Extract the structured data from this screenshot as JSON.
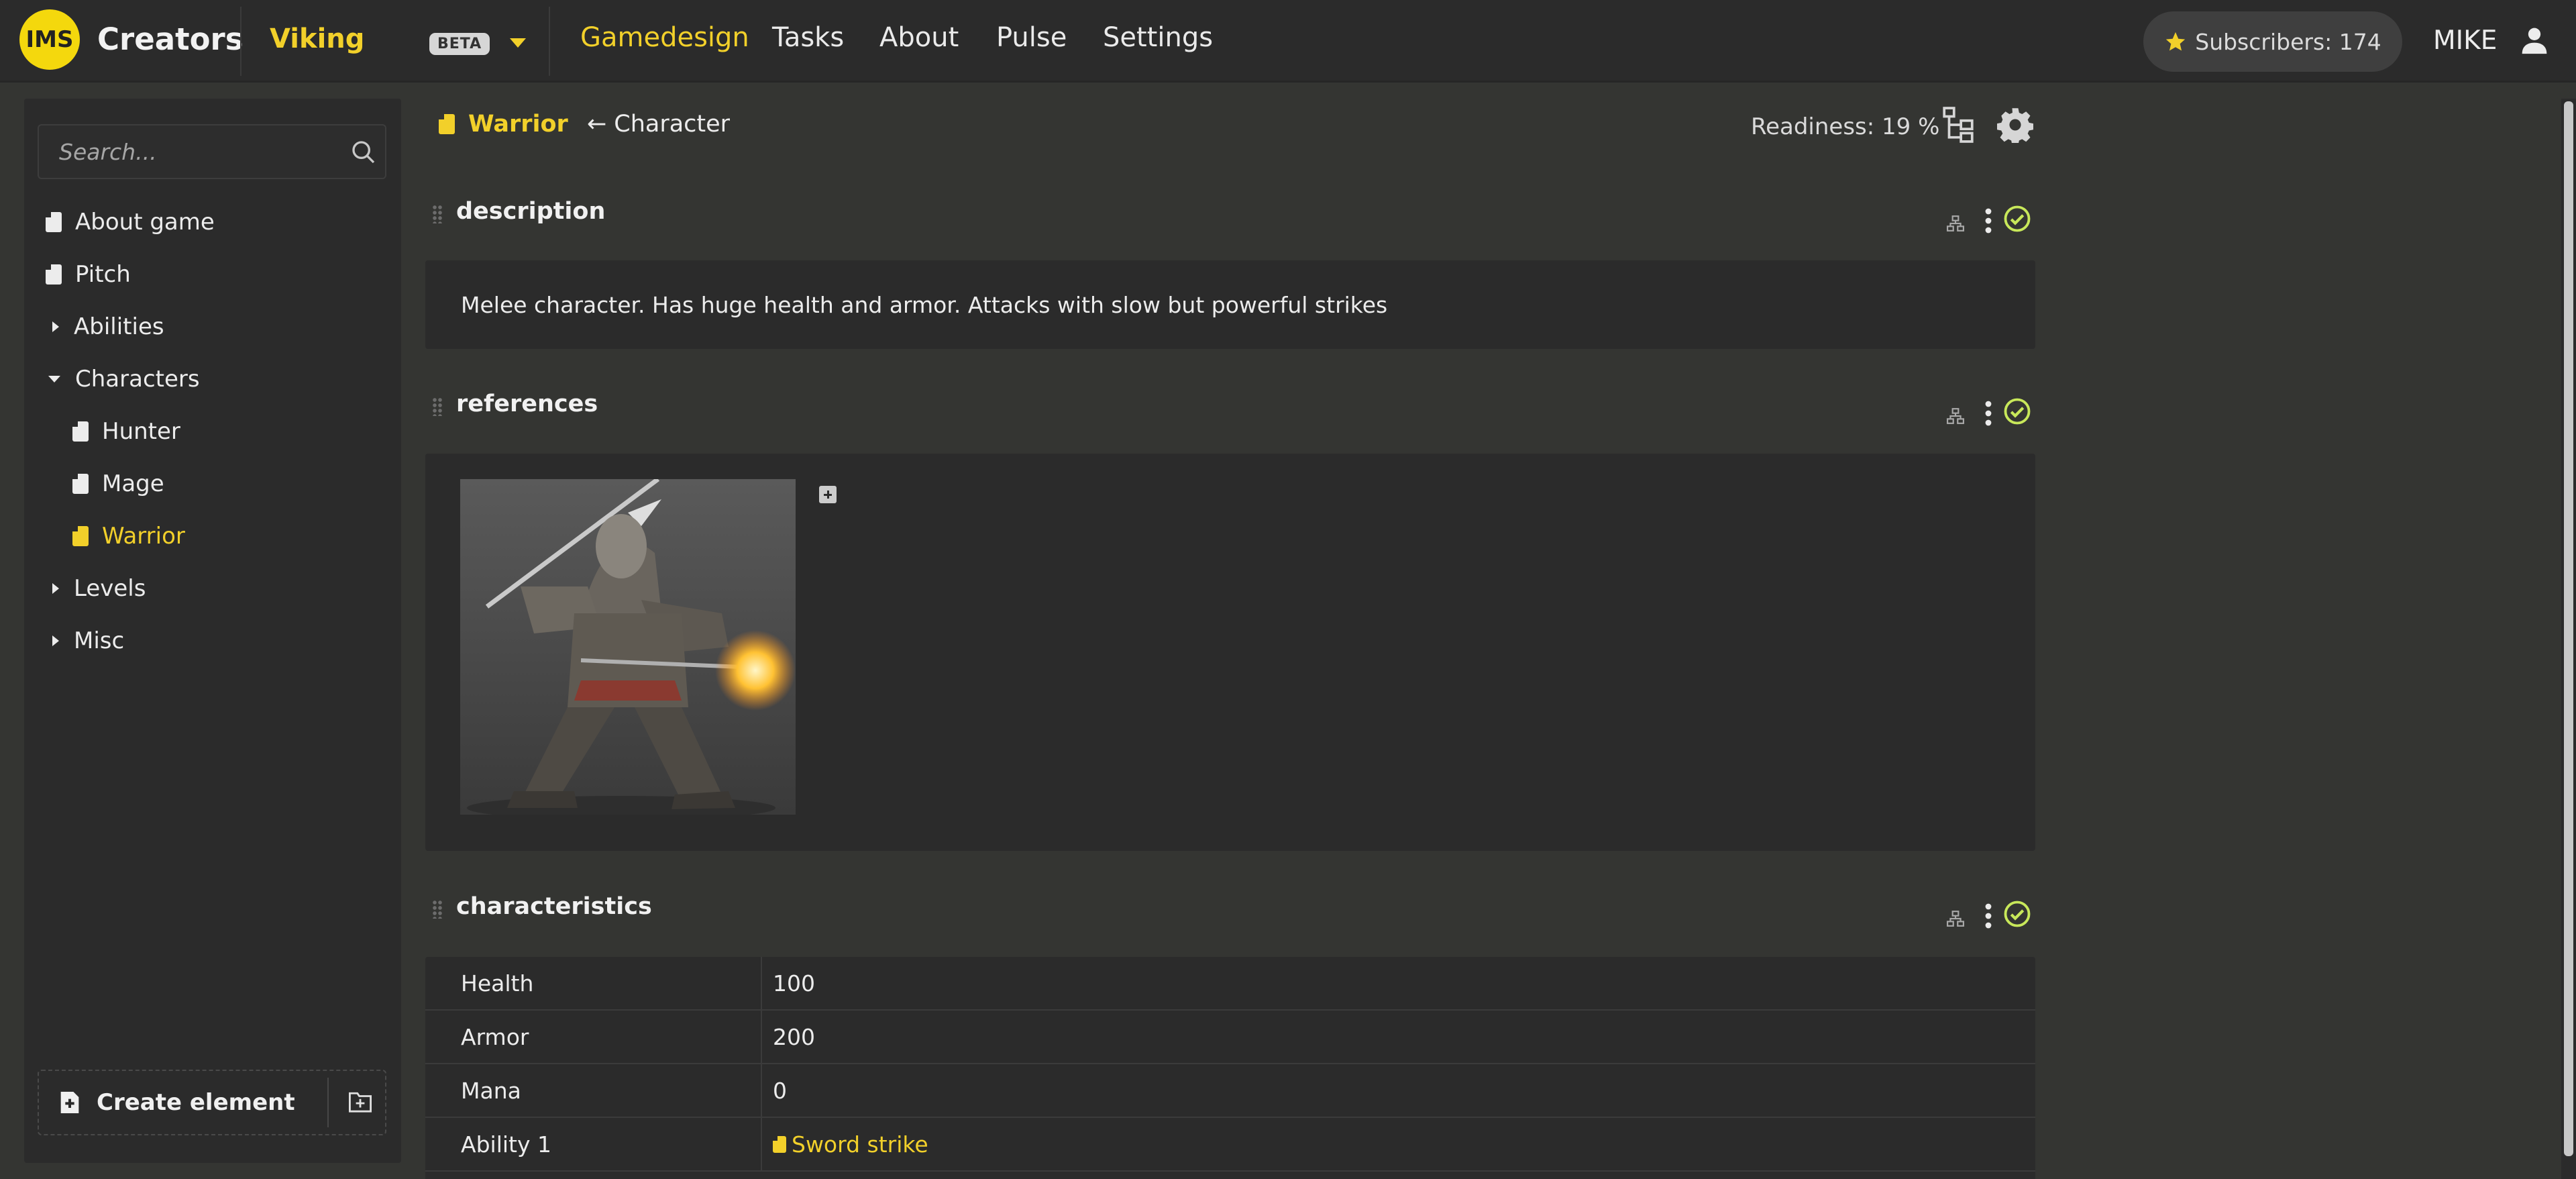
{
  "app": {
    "logo": "IMS",
    "brand": "Creators",
    "project": "Viking",
    "beta": "BETA"
  },
  "nav": [
    "Gamedesign",
    "Tasks",
    "About",
    "Pulse",
    "Settings"
  ],
  "subscribers": "Subscribers: 174",
  "user": "MIKE",
  "search": {
    "placeholder": "Search..."
  },
  "tree": [
    {
      "label": "About game",
      "type": "doc"
    },
    {
      "label": "Pitch",
      "type": "doc"
    },
    {
      "label": "Abilities",
      "type": "folder-collapsed"
    },
    {
      "label": "Characters",
      "type": "folder-expanded"
    },
    {
      "label": "Hunter",
      "type": "doc"
    },
    {
      "label": "Mage",
      "type": "doc"
    },
    {
      "label": "Warrior",
      "type": "doc",
      "selected": true
    },
    {
      "label": "Levels",
      "type": "folder-collapsed"
    },
    {
      "label": "Misc",
      "type": "folder-collapsed"
    }
  ],
  "create_label": "Create element",
  "breadcrumb": {
    "current": "Warrior",
    "parent": "← Character"
  },
  "readiness": "Readiness: 19 %",
  "sections": {
    "description": {
      "title": "description",
      "text": "Melee character. Has huge health and armor. Attacks with slow but powerful strikes"
    },
    "references": {
      "title": "references"
    },
    "characteristics": {
      "title": "characteristics",
      "rows": [
        {
          "key": "Health",
          "value": "100"
        },
        {
          "key": "Armor",
          "value": "200"
        },
        {
          "key": "Mana",
          "value": "0"
        },
        {
          "key": "Ability 1",
          "value": "Sword strike",
          "link": true
        }
      ]
    }
  },
  "colors": {
    "accent": "#f2d02a",
    "check": "#c8e85a",
    "bg": "#343532",
    "panel": "#2b2b2b"
  }
}
